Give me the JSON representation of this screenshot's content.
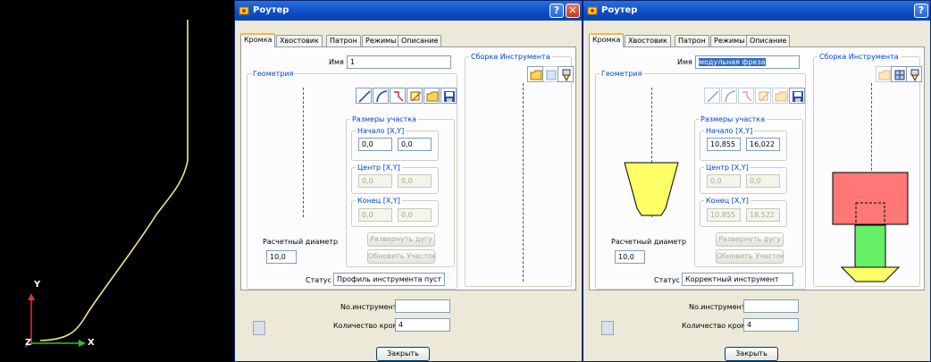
{
  "viewport": {
    "axis_y": "Y",
    "axis_z": "Z",
    "axis_x": "X",
    "colors": {
      "background": "#000000",
      "profile": "#f0e68c",
      "axis_red": "#e03030",
      "axis_green": "#30c030",
      "axis_blue": "#5050ff"
    }
  },
  "dialogs": [
    {
      "title": "Роутер",
      "help": "?",
      "close": "✕",
      "tabs": [
        "Кромка",
        "Хвостовик",
        "Патрон",
        "Режимы",
        "Описание"
      ],
      "active_tab": "Кромка",
      "name_label": "Имя",
      "name_value": "1",
      "geometry_label": "Геометрия",
      "assembly_label": "Сборка Инструмента",
      "segment_sizes_label": "Размеры участка",
      "start_label": "Начало [X,Y]",
      "start_x": "0,0",
      "start_y": "0,0",
      "center_label": "Центр [X,Y]",
      "center_x": "0,0",
      "center_y": "0,0",
      "end_label": "Конец [X,Y]",
      "end_x": "0,0",
      "end_y": "0,0",
      "flip_arc_btn": "Развернуть дугу",
      "update_segment_btn": "Обновить Участок",
      "calc_diameter_label": "Расчетный диаметр",
      "calc_diameter_value": "10,0",
      "status_label": "Статус",
      "status_value": "Профиль инструмента пуст",
      "tool_no_label": "No.инструмента",
      "tool_no_value": "",
      "edges_label": "Количество кромок",
      "edges_value": "4",
      "close_btn": "Закрыть"
    },
    {
      "title": "Роутер",
      "help": "?",
      "close": "✕",
      "tabs": [
        "Кромка",
        "Хвостовик",
        "Патрон",
        "Режимы",
        "Описание"
      ],
      "active_tab": "Кромка",
      "name_label": "Имя",
      "name_value": "модульная фреза",
      "geometry_label": "Геометрия",
      "assembly_label": "Сборка Инструмента",
      "segment_sizes_label": "Размеры участка",
      "start_label": "Начало [X,Y]",
      "start_x": "10,855",
      "start_y": "16,022",
      "center_label": "Центр [X,Y]",
      "center_x": "0,0",
      "center_y": "0,0",
      "end_label": "Конец [X,Y]",
      "end_x": "10.855",
      "end_y": "18.522",
      "flip_arc_btn": "Развернуть дугу",
      "update_segment_btn": "Обновить Участок",
      "calc_diameter_label": "Расчетный диаметр",
      "calc_diameter_value": "10,0",
      "status_label": "Статус",
      "status_value": "Корректный инструмент",
      "tool_no_label": "No.инструмента",
      "tool_no_value": "",
      "edges_label": "Количество кромок",
      "edges_value": "4",
      "close_btn": "Закрыть",
      "colors": {
        "cutter": "#ffff66",
        "holder": "#ff7777",
        "shank": "#66ee66"
      }
    }
  ]
}
